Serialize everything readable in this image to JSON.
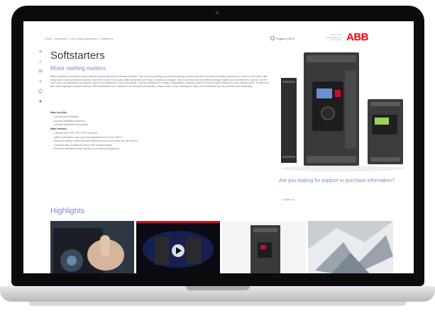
{
  "breadcrumb": "Home  >  Softstarters  >  Low voltage softstarters  >  Softstarters",
  "header": {
    "language": "English (US) ▾",
    "tagline": "Power and productivity for a better world",
    "logo_text": "ABB"
  },
  "sidebar": {
    "icons": [
      "menu-icon",
      "search-icon",
      "mail-icon",
      "share-icon",
      "print-icon",
      "user-icon"
    ]
  },
  "main": {
    "title": "Softstarters",
    "subtitle": "Motor starting matters",
    "intro": "ABB's softstarters increase a motor's lifetime by protecting it from electrical stresses. They do so by starting your electrical starting converts that with conventional starting methods your drive is in the motor. With many built-in motor protection features, your motor is safe in its hands. ABB's softstarters are easy to install and configure. Easy to use and with pre-defined settings, reliable and cost-efficient to operate. Get the most out of your application by using the right mix of softstarters, motors and drives. They are designed for a range of applications, making it simpler to find the right softstarter for your specific needs. Furthermore, with robust application specific features, ABB's softstarters can contribute to an increased productivity. Torque control, pump cleaning and many more features let you do more than just softstarting.",
    "benefits_heading": "Main benefits",
    "benefits": [
      "Secure motor reliability",
      "Improve installation efficiency",
      "Increase application productivity"
    ],
    "features_heading": "Main features",
    "features": [
      "Offering PSR, PSE, PST, PSTX and PSE",
      "ABB's softstarters cover any motor application from 3 A to 1810 A",
      "Reduced starting current and less electrical stress on the motor and the network",
      "Fast and easy to install and set up with a small footprint",
      "Reduced mechanical wear and tear on mechanical equipment"
    ]
  },
  "support": {
    "question": "Are you looking for support or purchase information?",
    "contact_link": "→ Contact us"
  },
  "highlights": {
    "title": "Highlights"
  },
  "colors": {
    "brand": "#ff000f",
    "link": "#6a8fd0",
    "text": "#3a3a3a"
  }
}
